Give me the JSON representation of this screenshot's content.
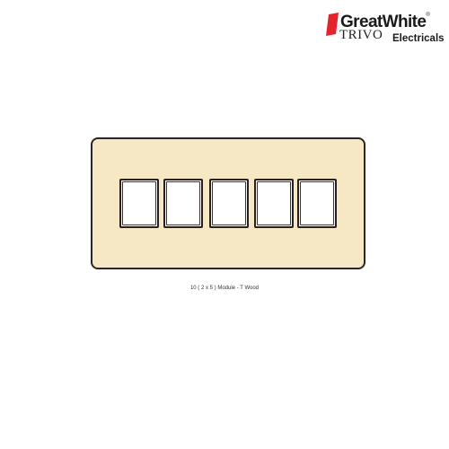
{
  "brand": {
    "name": "GreatWhite",
    "registered_mark": "®",
    "subtitle": "Electricals",
    "series": "TRIVO",
    "accent_color": "#e3242b"
  },
  "product": {
    "plate_color": "#f7e8c5",
    "frame_count": 5,
    "caption": "10 ( 2 x 5 ) Module - T Wood"
  }
}
